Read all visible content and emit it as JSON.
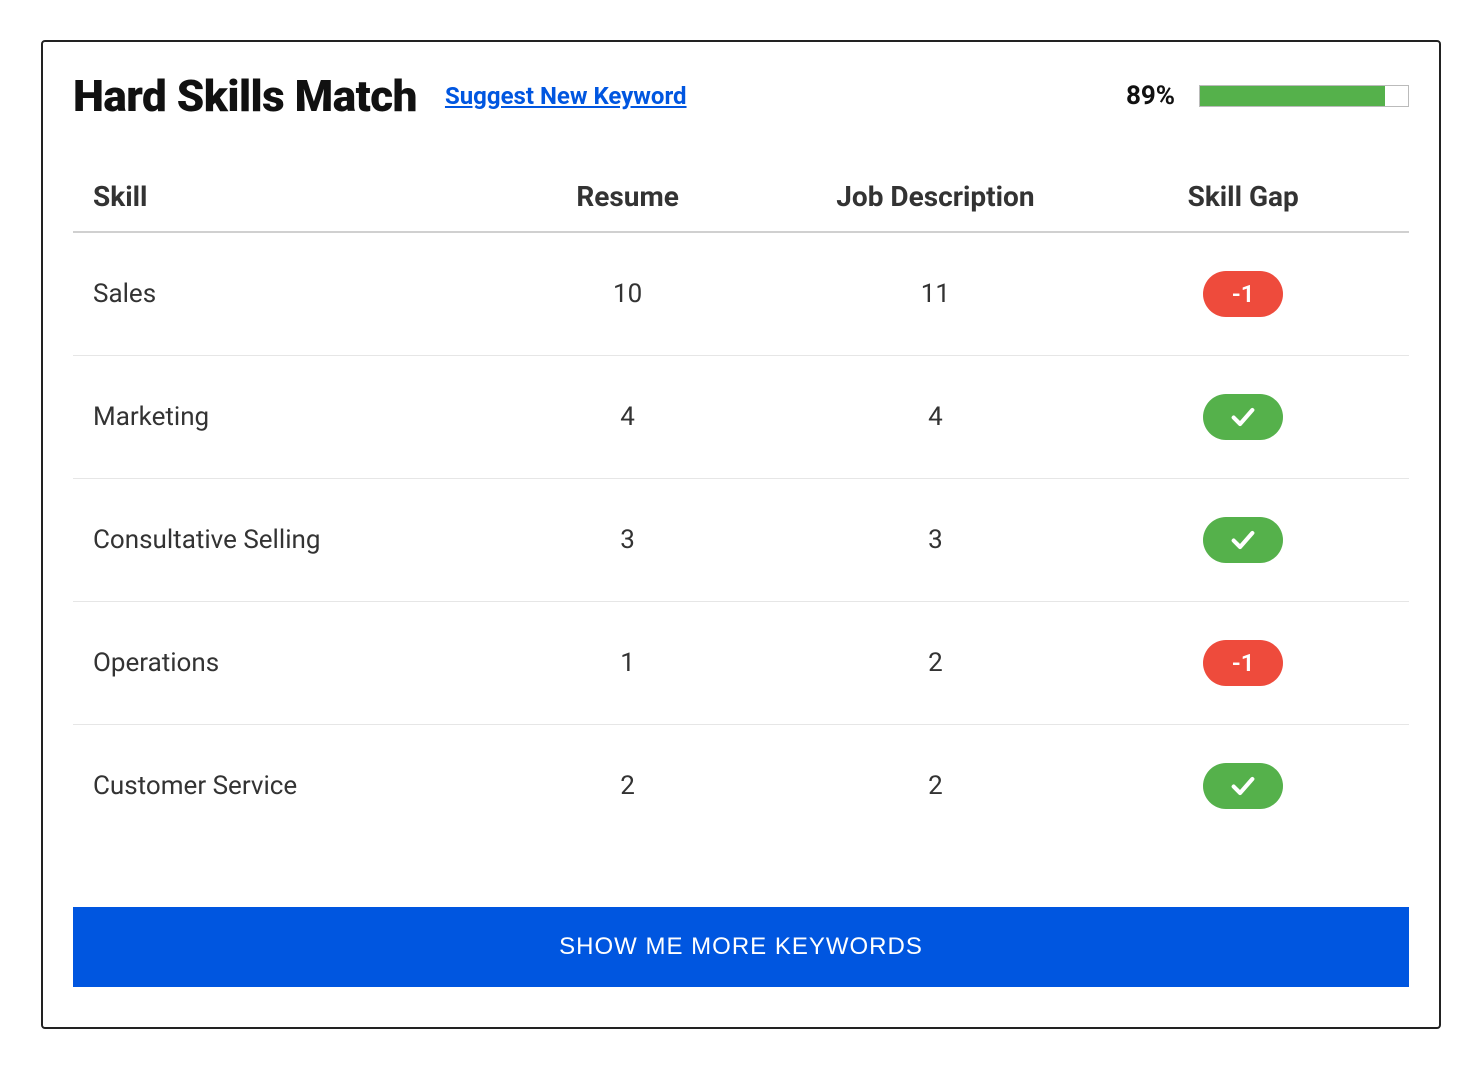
{
  "header": {
    "title": "Hard Skills Match",
    "suggest_link": "Suggest New Keyword",
    "percent": "89%",
    "progress_pct": 89
  },
  "columns": {
    "skill": "Skill",
    "resume": "Resume",
    "job_desc": "Job Description",
    "gap": "Skill Gap"
  },
  "rows": [
    {
      "skill": "Sales",
      "resume": "10",
      "job_desc": "11",
      "gap_type": "deficit",
      "gap_value": "-1"
    },
    {
      "skill": "Marketing",
      "resume": "4",
      "job_desc": "4",
      "gap_type": "match",
      "gap_value": ""
    },
    {
      "skill": "Consultative Selling",
      "resume": "3",
      "job_desc": "3",
      "gap_type": "match",
      "gap_value": ""
    },
    {
      "skill": "Operations",
      "resume": "1",
      "job_desc": "2",
      "gap_type": "deficit",
      "gap_value": "-1"
    },
    {
      "skill": "Customer Service",
      "resume": "2",
      "job_desc": "2",
      "gap_type": "match",
      "gap_value": ""
    }
  ],
  "cta": {
    "show_more": "SHOW ME MORE KEYWORDS"
  },
  "colors": {
    "accent_blue": "#0056e0",
    "green": "#55b14b",
    "red": "#ee4b3c"
  }
}
